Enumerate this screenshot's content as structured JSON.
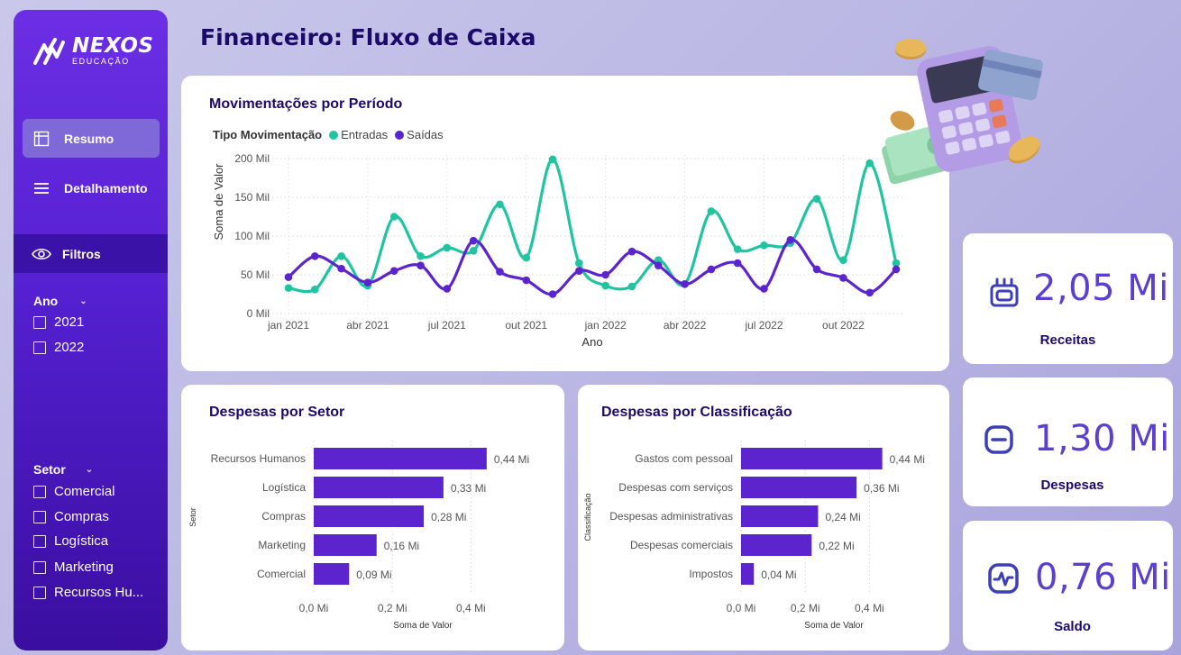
{
  "page": {
    "title": "Financeiro: Fluxo de Caixa"
  },
  "brand": {
    "name": "NEXOS",
    "sub": "EDUCAÇÃO"
  },
  "nav": {
    "items": [
      {
        "label": "Resumo",
        "icon": "layout-icon",
        "active": true
      },
      {
        "label": "Detalhamento",
        "icon": "menu-icon",
        "active": false
      }
    ],
    "filters_label": "Filtros"
  },
  "slicers": {
    "ano": {
      "title": "Ano",
      "items": [
        "2021",
        "2022"
      ]
    },
    "setor": {
      "title": "Setor",
      "items": [
        "Comercial",
        "Compras",
        "Logística",
        "Marketing",
        "Recursos Hu..."
      ]
    }
  },
  "colors": {
    "entradas": "#20c4a0",
    "saidas": "#5b24cf",
    "bar": "#5b24cf",
    "accent": "#5a3fd0"
  },
  "line_chart": {
    "title": "Movimentações por Período",
    "legend_title": "Tipo Movimentação",
    "y_ticks": [
      "200 Mil",
      "150 Mil",
      "100 Mil",
      "50 Mil",
      "0 Mil"
    ],
    "x_ticks": [
      "jan 2021",
      "abr 2021",
      "jul 2021",
      "out 2021",
      "jan 2022",
      "abr 2022",
      "jul 2022",
      "out 2022"
    ]
  },
  "bar_setor": {
    "title": "Despesas por Setor",
    "ylabel": "Setor",
    "xlabel": "Soma de Valor",
    "x_ticks": [
      "0,0 Mi",
      "0,2 Mi",
      "0,4 Mi"
    ]
  },
  "bar_class": {
    "title": "Despesas por Classificação",
    "ylabel": "Classificação",
    "xlabel": "Soma de Valor",
    "x_ticks": [
      "0,0 Mi",
      "0,2 Mi",
      "0,4 Mi"
    ]
  },
  "kpis": [
    {
      "value": "2,05 Mi",
      "label": "Receitas",
      "icon": "wallet-icon"
    },
    {
      "value": "1,30 Mi",
      "label": "Despesas",
      "icon": "minus-icon"
    },
    {
      "value": "0,76 Mi",
      "label": "Saldo",
      "icon": "pulse-icon"
    }
  ],
  "chart_data": [
    {
      "type": "line",
      "title": "Movimentações por Período",
      "xlabel": "Ano",
      "ylabel": "Soma de Valor",
      "ylim": [
        0,
        200000
      ],
      "x": [
        "jan 2021",
        "fev 2021",
        "mar 2021",
        "abr 2021",
        "mai 2021",
        "jun 2021",
        "jul 2021",
        "ago 2021",
        "set 2021",
        "out 2021",
        "nov 2021",
        "dez 2021",
        "jan 2022",
        "fev 2022",
        "mar 2022",
        "abr 2022",
        "mai 2022",
        "jun 2022",
        "jul 2022",
        "ago 2022",
        "set 2022",
        "out 2022",
        "nov 2022",
        "dez 2022"
      ],
      "series": [
        {
          "name": "Entradas",
          "values": [
            33000,
            31000,
            74000,
            36000,
            125000,
            74000,
            85000,
            81000,
            141000,
            72000,
            199000,
            65000,
            36000,
            35000,
            69000,
            38000,
            132000,
            83000,
            88000,
            91000,
            148000,
            69000,
            194000,
            65000
          ]
        },
        {
          "name": "Saídas",
          "values": [
            47000,
            74000,
            58000,
            40000,
            55000,
            62000,
            32000,
            94000,
            54000,
            43000,
            25000,
            55000,
            50000,
            80000,
            62000,
            38000,
            57000,
            65000,
            32000,
            95000,
            57000,
            46000,
            27000,
            57000
          ]
        }
      ],
      "legend": "top-left"
    },
    {
      "type": "bar",
      "title": "Despesas por Setor",
      "xlabel": "Soma de Valor",
      "ylabel": "Setor",
      "categories": [
        "Recursos Humanos",
        "Logística",
        "Compras",
        "Marketing",
        "Comercial"
      ],
      "values": [
        0.44,
        0.33,
        0.28,
        0.16,
        0.09
      ],
      "data_labels": [
        "0,44 Mi",
        "0,33 Mi",
        "0,28 Mi",
        "0,16 Mi",
        "0,09 Mi"
      ],
      "xlim": [
        0,
        0.5
      ]
    },
    {
      "type": "bar",
      "title": "Despesas por Classificação",
      "xlabel": "Soma de Valor",
      "ylabel": "Classificação",
      "categories": [
        "Gastos com pessoal",
        "Despesas com serviços",
        "Despesas administrativas",
        "Despesas comerciais",
        "Impostos"
      ],
      "values": [
        0.44,
        0.36,
        0.24,
        0.22,
        0.04
      ],
      "data_labels": [
        "0,44 Mi",
        "0,36 Mi",
        "0,24 Mi",
        "0,22 Mi",
        "0,04 Mi"
      ],
      "xlim": [
        0,
        0.5
      ]
    }
  ]
}
